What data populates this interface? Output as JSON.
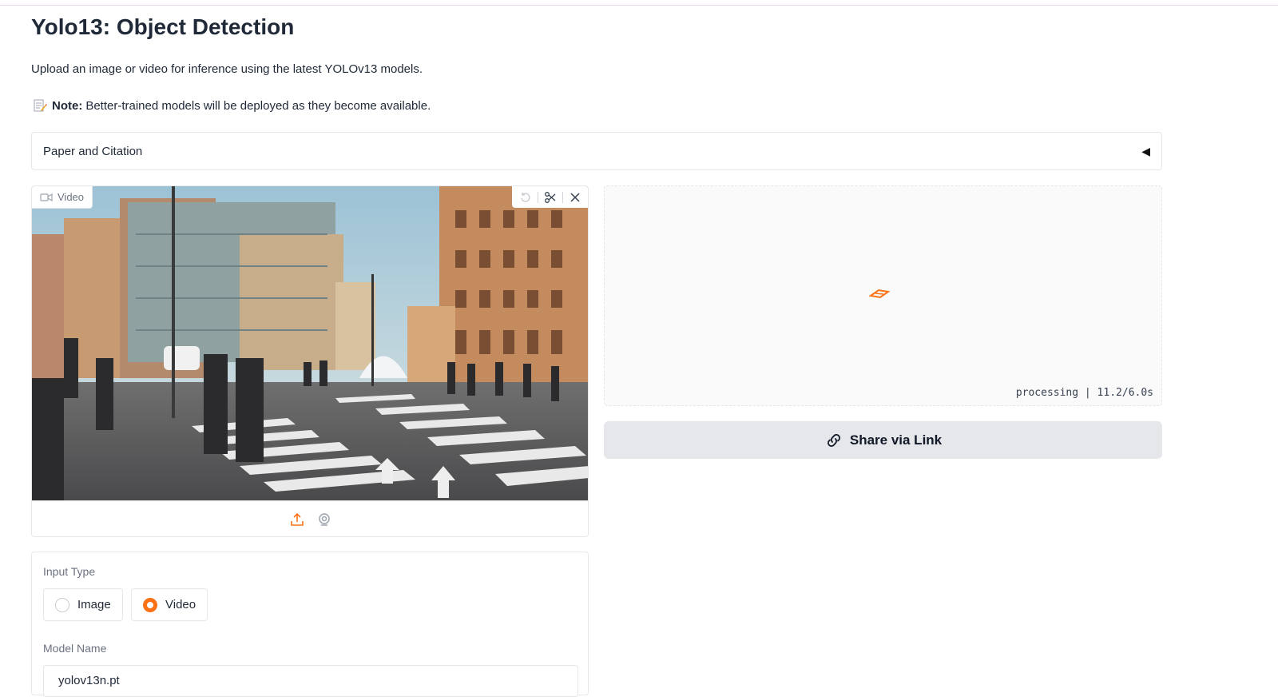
{
  "header": {
    "title": "Yolo13: Object Detection",
    "description": "Upload an image or video for inference using the latest YOLOv13 models.",
    "note_label": "Note:",
    "note_text": "Better-trained models will be deployed as they become available."
  },
  "accordion": {
    "label": "Paper and Citation",
    "arrow": "◀"
  },
  "video_input": {
    "badge_label": "Video"
  },
  "output": {
    "status": "processing | 11.2/6.0s"
  },
  "share_button": {
    "label": "Share via Link"
  },
  "controls": {
    "input_type_label": "Input Type",
    "options": [
      "Image",
      "Video"
    ],
    "selected": "Video",
    "model_name_label": "Model Name",
    "model_value": "yolov13n.pt"
  },
  "colors": {
    "accent": "#f97316",
    "border": "#e5e7eb",
    "button_bg": "#e5e7eb"
  }
}
